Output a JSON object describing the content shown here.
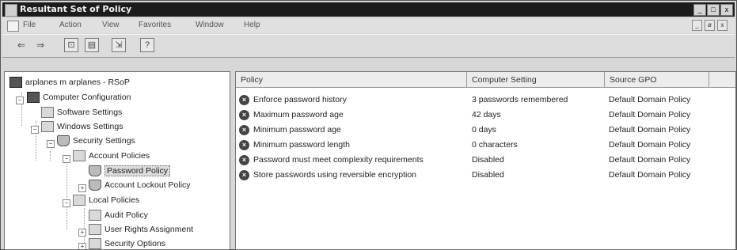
{
  "window": {
    "title": "Resultant Set of Policy",
    "controls": [
      "_",
      "□",
      "x"
    ]
  },
  "menu": {
    "items": [
      "File",
      "Action",
      "View",
      "Favorites",
      "Window",
      "Help"
    ],
    "mdi_controls": [
      "_",
      "ø",
      "x"
    ]
  },
  "toolbar": {
    "buttons": [
      "back-icon",
      "forward-icon",
      "up-icon",
      "show-hide-tree-icon",
      "export-icon",
      "help-icon"
    ]
  },
  "tree": {
    "root": "arplanes m arplanes - RSoP",
    "computer_configuration": "Computer Configuration",
    "software_settings": "Software Settings",
    "windows_settings": "Windows Settings",
    "security_settings": "Security Settings",
    "account_policies": "Account Policies",
    "password_policy": "Password Policy",
    "account_lockout_policy": "Account Lockout Policy",
    "local_policies": "Local Policies",
    "audit_policy": "Audit Policy",
    "user_rights_assignment": "User Rights Assignment",
    "security_options": "Security Options"
  },
  "table": {
    "headers": [
      "Policy",
      "Computer Setting",
      "Source GPO"
    ],
    "rows": [
      {
        "policy": "Enforce password history",
        "setting": "3 passwords remembered",
        "source": "Default Domain Policy"
      },
      {
        "policy": "Maximum password age",
        "setting": "42 days",
        "source": "Default Domain Policy"
      },
      {
        "policy": "Minimum password age",
        "setting": "0 days",
        "source": "Default Domain Policy"
      },
      {
        "policy": "Minimum password length",
        "setting": "0 characters",
        "source": "Default Domain Policy"
      },
      {
        "policy": "Password must meet complexity requirements",
        "setting": "Disabled",
        "source": "Default Domain Policy"
      },
      {
        "policy": "Store passwords using reversible encryption",
        "setting": "Disabled",
        "source": "Default Domain Policy"
      }
    ]
  }
}
